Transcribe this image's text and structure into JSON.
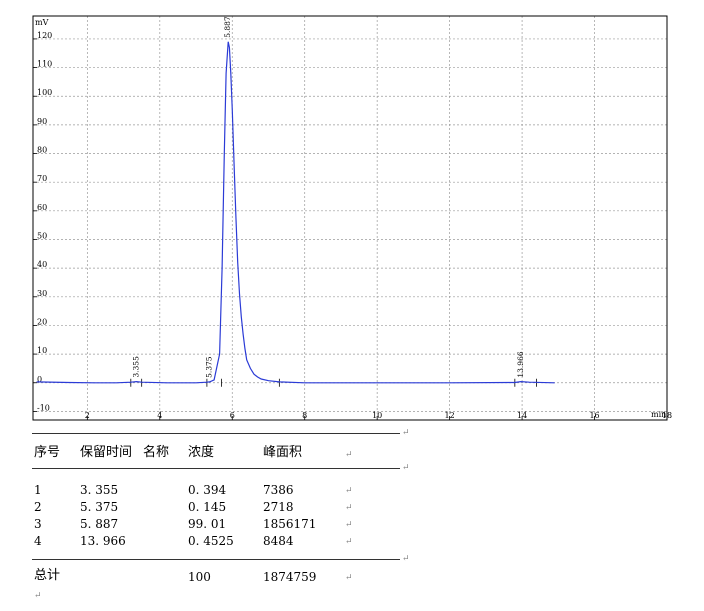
{
  "chart_data": {
    "type": "line",
    "ylabel": "mV",
    "xlabel": "min",
    "xlim": [
      0.5,
      18.0
    ],
    "ylim": [
      -13,
      128
    ],
    "x_ticks": [
      2,
      4,
      6,
      8,
      10,
      12,
      14,
      16,
      18
    ],
    "y_ticks": [
      -10,
      0,
      10,
      20,
      30,
      40,
      50,
      60,
      70,
      80,
      90,
      100,
      110,
      120
    ],
    "grid": true,
    "line_color": "#2b3bd6",
    "series": [
      {
        "x": [
          0.6,
          1.5,
          2.2,
          2.8,
          3.2,
          3.355,
          3.5,
          4.2,
          5.0,
          5.3,
          5.375,
          5.5,
          5.65,
          5.72,
          5.78,
          5.83,
          5.887,
          5.92,
          5.96,
          6.0,
          6.05,
          6.1,
          6.15,
          6.2,
          6.25,
          6.3,
          6.35,
          6.4,
          6.5,
          6.6,
          6.7,
          6.8,
          7.0,
          7.3,
          8.0,
          10.0,
          12.0,
          13.8,
          13.966,
          14.2,
          14.9
        ],
        "y": [
          0.3,
          0.1,
          0.0,
          0.0,
          0.2,
          0.4,
          0.2,
          0.0,
          0.0,
          0.2,
          0.3,
          1.0,
          10,
          40,
          80,
          108,
          119,
          117,
          108,
          95,
          76,
          58,
          42,
          31,
          23,
          17,
          12,
          8,
          5,
          3,
          2,
          1.3,
          0.7,
          0.3,
          0.0,
          0.0,
          0.0,
          0.1,
          0.4,
          0.2,
          0.0
        ]
      }
    ],
    "peak_labels": [
      {
        "x": 3.355,
        "label": "3.355"
      },
      {
        "x": 5.375,
        "label": "5.375"
      },
      {
        "x": 5.887,
        "label": "5.887"
      },
      {
        "x": 13.966,
        "label": "13.966"
      }
    ],
    "integration_markers": [
      3.2,
      3.5,
      5.3,
      5.7,
      7.3,
      13.8,
      14.4
    ]
  },
  "table": {
    "headers": {
      "index": "序号",
      "retention_time": "保留时间",
      "name": "名称",
      "concentration": "浓度",
      "peak_area": "峰面积"
    },
    "rows": [
      {
        "index": "1",
        "retention_time": "3. 355",
        "name": "",
        "concentration": "0. 394",
        "peak_area": "7386"
      },
      {
        "index": "2",
        "retention_time": "5. 375",
        "name": "",
        "concentration": "0. 145",
        "peak_area": "2718"
      },
      {
        "index": "3",
        "retention_time": "5. 887",
        "name": "",
        "concentration": "99. 01",
        "peak_area": "1856171"
      },
      {
        "index": "4",
        "retention_time": "13. 966",
        "name": "",
        "concentration": "0. 4525",
        "peak_area": "8484"
      }
    ],
    "total": {
      "label": "总计",
      "concentration": "100",
      "peak_area": "1874759"
    },
    "return_mark": "↵"
  }
}
